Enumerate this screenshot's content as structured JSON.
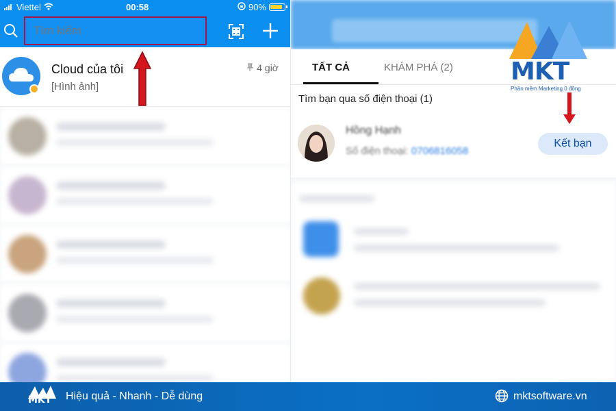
{
  "status_bar": {
    "carrier": "Viettel",
    "time": "00:58",
    "battery": "90%"
  },
  "search": {
    "placeholder": "Tìm kiếm"
  },
  "chat_list": [
    {
      "name": "Cloud của tôi",
      "preview": "[Hình ảnh]",
      "time": "4 giờ"
    }
  ],
  "tabs": [
    {
      "label": "TẤT CẢ"
    },
    {
      "label": "KHÁM PHÁ (2)"
    }
  ],
  "find_by_phone": {
    "title": "Tìm bạn qua số điện thoại (1)",
    "contact_name": "Hồng Hạnh",
    "phone_label": "Số điện thoại:",
    "phone_number": "0706816058",
    "add_button": "Kết bạn"
  },
  "brand": {
    "logo_text": "MKT",
    "tagline": "Phần mềm Marketing 0 đồng",
    "slogan": "Hiệu quả - Nhanh - Dễ dùng",
    "website": "mktsoftware.vn"
  },
  "colors": {
    "header_blue": "#0a8ef0",
    "highlight_border": "#a0174c",
    "arrow_red": "#d4161e",
    "footer_blue": "#0a70c4"
  }
}
